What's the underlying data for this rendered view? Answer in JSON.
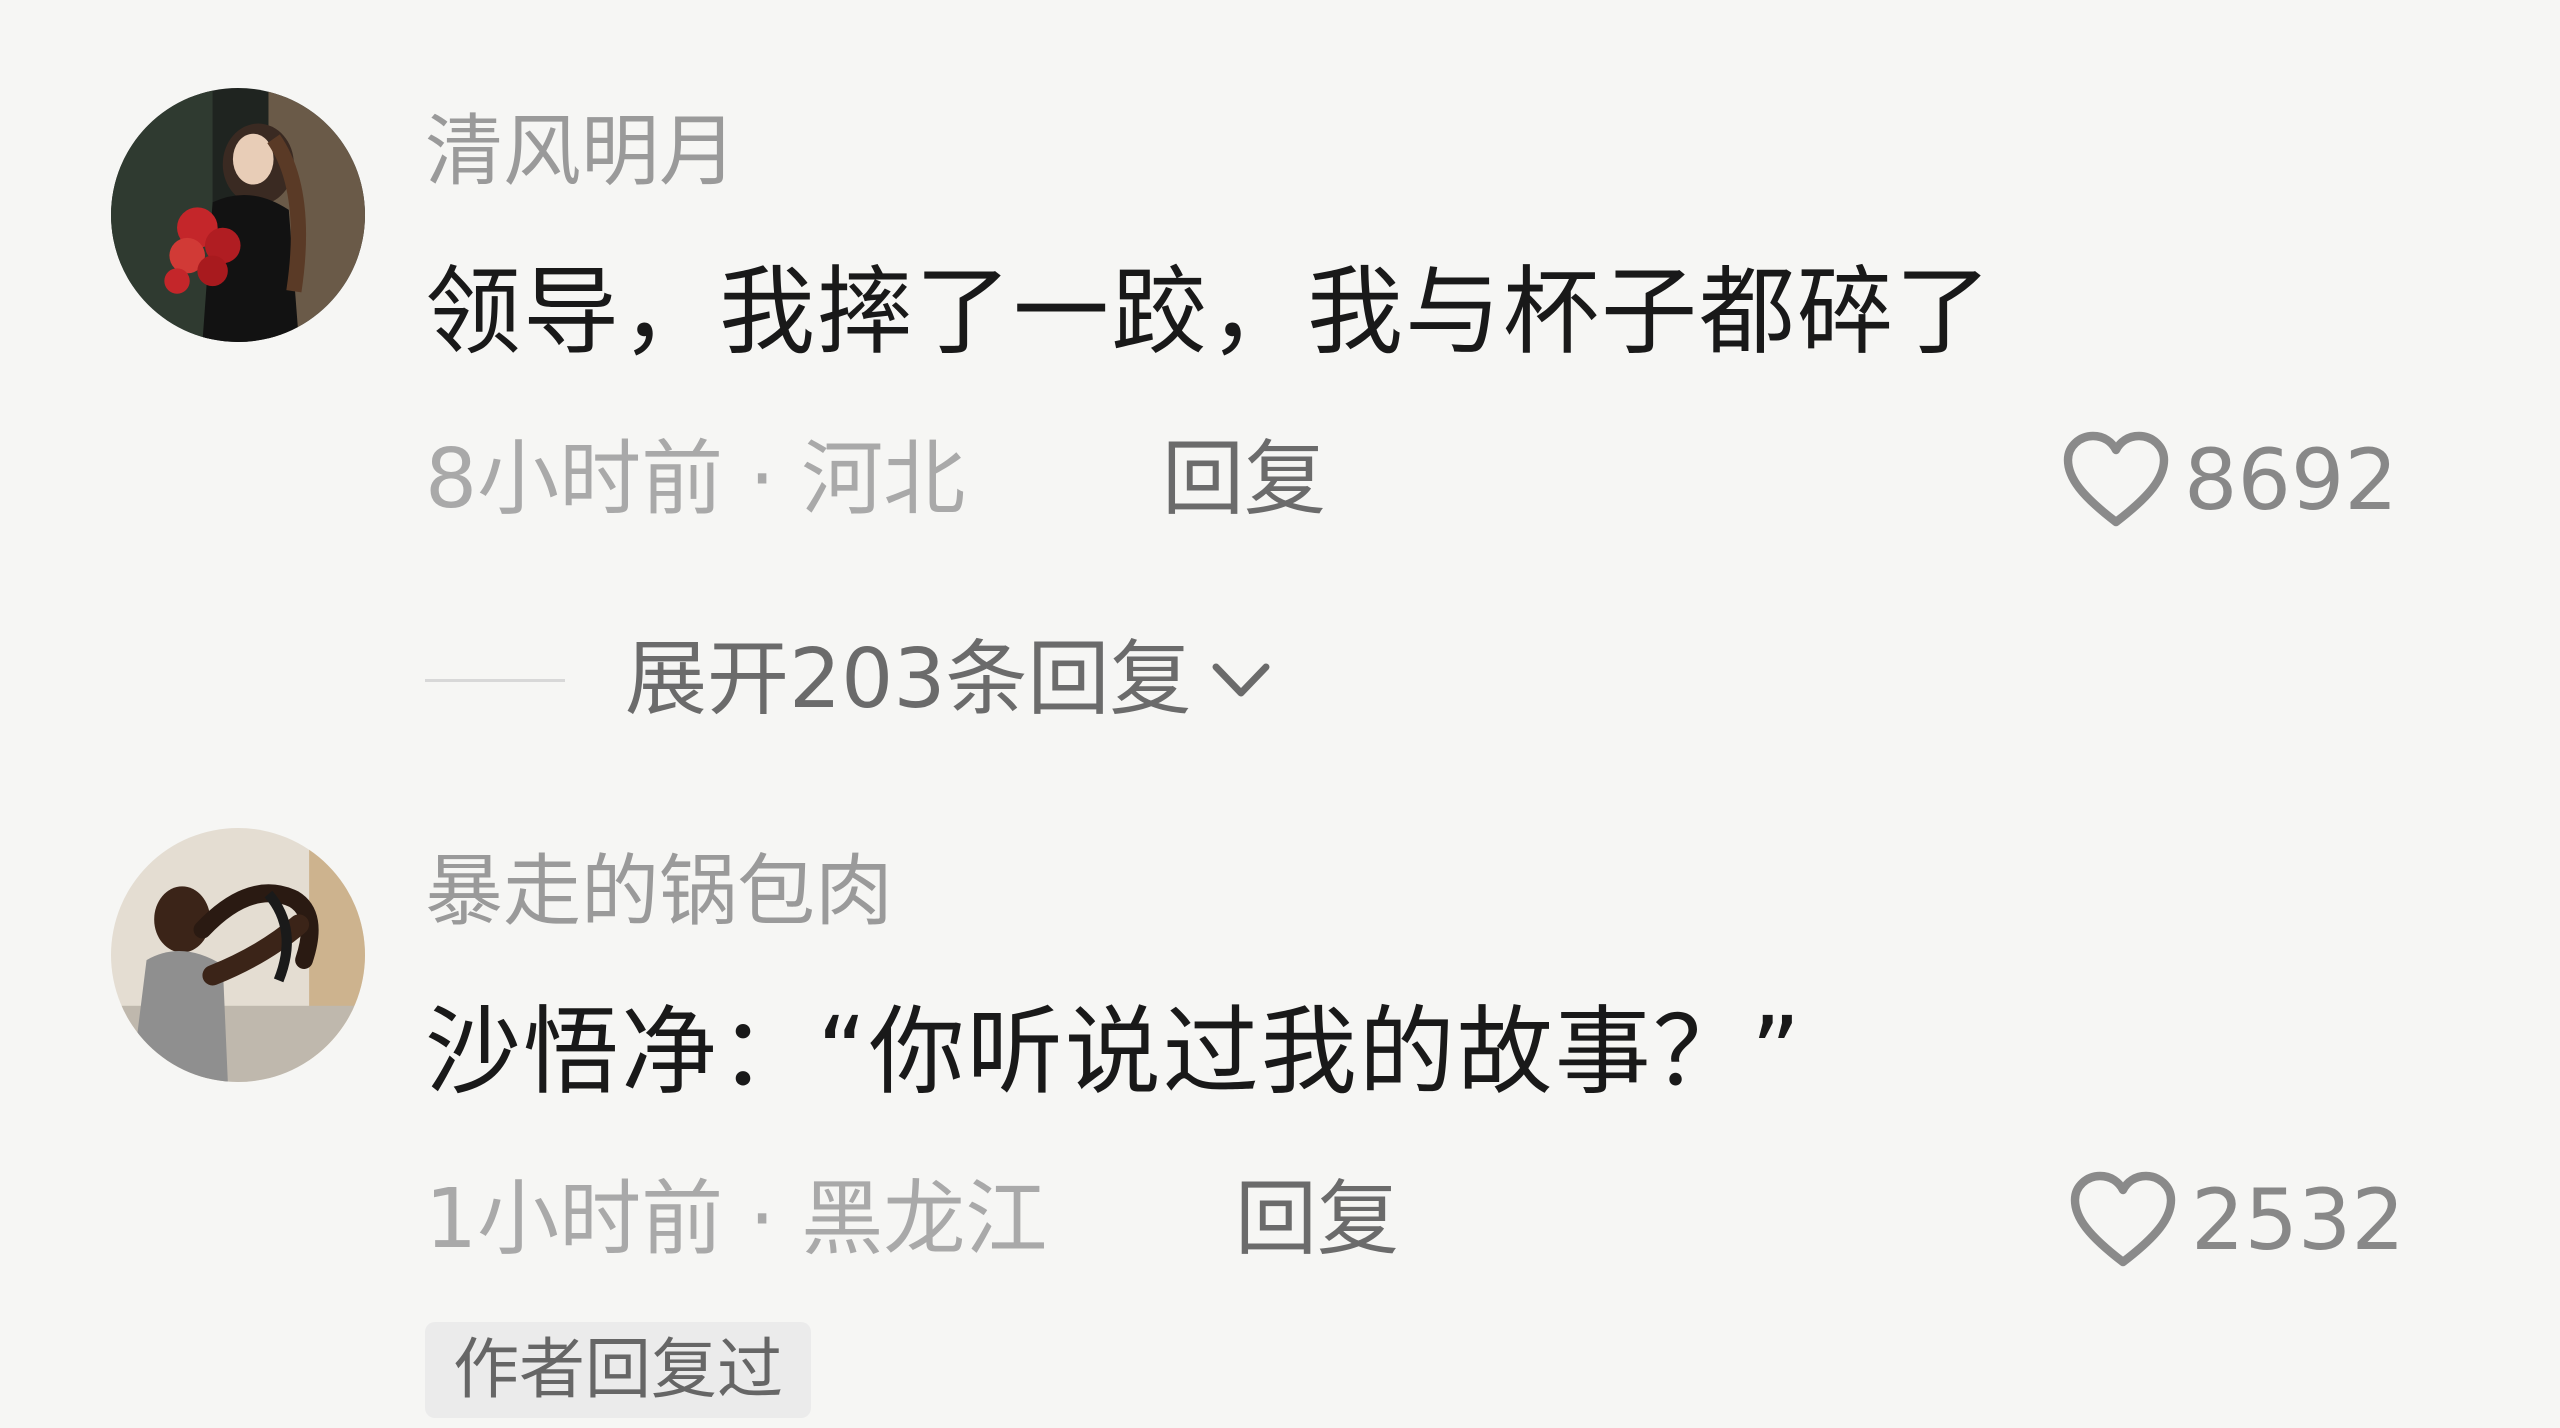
{
  "comments": [
    {
      "username": "清风明月",
      "content": "领导，我摔了一跤，我与杯子都碎了",
      "time": "8小时前",
      "separator": "·",
      "location": "河北",
      "reply_label": "回复",
      "like_icon": "heart-outline-icon",
      "likes": "8692",
      "expand_label": "展开203条回复",
      "expand_icon": "chevron-down-icon"
    },
    {
      "username": "暴走的锅包肉",
      "content": "沙悟净：“你听说过我的故事？”",
      "time": "1小时前",
      "separator": "·",
      "location": "黑龙江",
      "reply_label": "回复",
      "like_icon": "heart-outline-icon",
      "likes": "2532",
      "badge": "作者回复过"
    }
  ],
  "colors": {
    "background": "#f6f6f4",
    "username": "#9a9a9a",
    "content": "#191919",
    "meta": "#a9a9a9",
    "action": "#6b6b6b"
  }
}
